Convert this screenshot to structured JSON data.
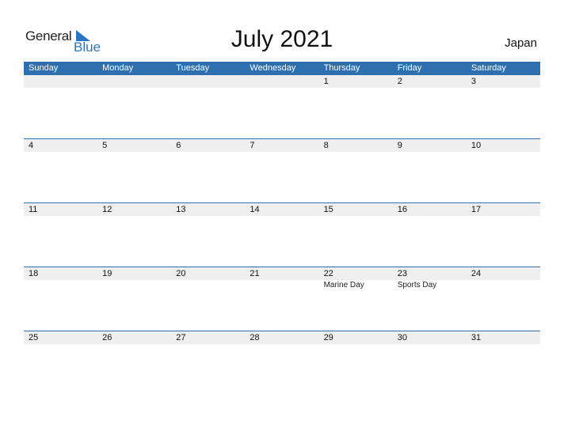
{
  "logo": {
    "general": "General",
    "blue": "Blue"
  },
  "title": "July 2021",
  "country": "Japan",
  "weekdays": [
    "Sunday",
    "Monday",
    "Tuesday",
    "Wednesday",
    "Thursday",
    "Friday",
    "Saturday"
  ],
  "weeks": [
    {
      "days": [
        "",
        "",
        "",
        "",
        "1",
        "2",
        "3"
      ],
      "events": [
        "",
        "",
        "",
        "",
        "",
        "",
        ""
      ]
    },
    {
      "days": [
        "4",
        "5",
        "6",
        "7",
        "8",
        "9",
        "10"
      ],
      "events": [
        "",
        "",
        "",
        "",
        "",
        "",
        ""
      ]
    },
    {
      "days": [
        "11",
        "12",
        "13",
        "14",
        "15",
        "16",
        "17"
      ],
      "events": [
        "",
        "",
        "",
        "",
        "",
        "",
        ""
      ]
    },
    {
      "days": [
        "18",
        "19",
        "20",
        "21",
        "22",
        "23",
        "24"
      ],
      "events": [
        "",
        "",
        "",
        "",
        "Marine Day",
        "Sports Day",
        ""
      ]
    },
    {
      "days": [
        "25",
        "26",
        "27",
        "28",
        "29",
        "30",
        "31"
      ],
      "events": [
        "",
        "",
        "",
        "",
        "",
        "",
        ""
      ]
    }
  ]
}
